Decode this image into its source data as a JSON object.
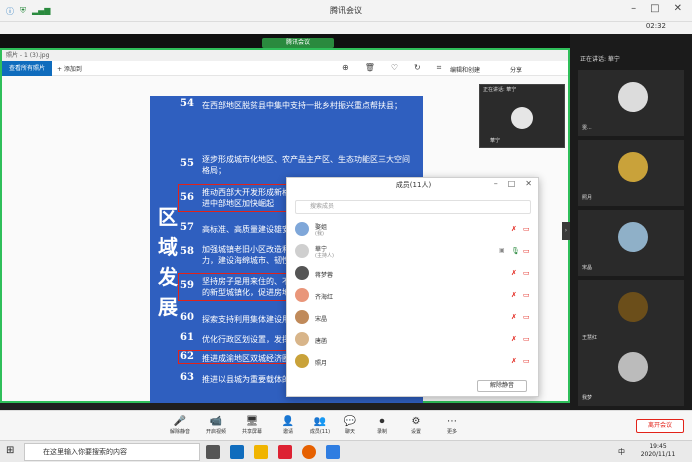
{
  "app": {
    "title": "腾讯会议",
    "time": "02:32"
  },
  "share": {
    "chip": "腾讯会议",
    "viewer_title": "照片 - 1 (3).jpg"
  },
  "viewer_toolbar": {
    "view_all": "查看所有照片",
    "add_to": "+ 添加到",
    "edit_create": "编辑和创建",
    "share": "分享"
  },
  "slide": {
    "vertical_title": [
      "区",
      "域",
      "发",
      "展"
    ],
    "items": [
      {
        "num": "54",
        "text": "在西部地区脱贫县中集中支持一批乡村振兴重点帮扶县；"
      },
      {
        "num": "55",
        "text": "逐步形成城市化地区、农产品主产区、生态功能区三大空间格局；"
      },
      {
        "num": "56",
        "text": "推动西部大开发形成新格局，推动东北振兴取得新突破，促进中部地区加快崛起"
      },
      {
        "num": "57",
        "text": "高标准、高质量建设雄安新区"
      },
      {
        "num": "58",
        "text": "加强城镇老旧小区改造和社区建设，增强城市防洪排涝能力，建设海绵城市、韧性城市"
      },
      {
        "num": "59",
        "text": "坚持房子是用来住的、不是用来炒的定位，推进以人为核心的新型城镇化，促进房地产市场平稳健康发展"
      },
      {
        "num": "60",
        "text": "探索支持利用集体建设用地按照规划建设租赁住房"
      },
      {
        "num": "61",
        "text": "优化行政区划设置，发挥中心城市和城市群带动作用"
      },
      {
        "num": "62",
        "text": "推进成渝地区双城经济圈建设"
      },
      {
        "num": "63",
        "text": "推进以县城为重要载体的城镇化建设"
      }
    ]
  },
  "cam_preview": {
    "label": "正在讲话: 華宁",
    "name": "華宁"
  },
  "members": {
    "title": "成员(11人)",
    "search_placeholder": "搜索成员",
    "list": [
      {
        "name": "娶姐",
        "sub": "(我)",
        "color": "#7fa7d9"
      },
      {
        "name": "華宁",
        "sub": "(主持人)",
        "color": "#cfcfcf"
      },
      {
        "name": "蒋梦蓉",
        "sub": "",
        "color": "#555"
      },
      {
        "name": "齐海红",
        "sub": "",
        "color": "#e9967a"
      },
      {
        "name": "宋晶",
        "sub": "",
        "color": "#c08a5a"
      },
      {
        "name": "唐菡",
        "sub": "",
        "color": "#d8b58a"
      },
      {
        "name": "照月",
        "sub": "",
        "color": "#c9a23a"
      }
    ],
    "unmute_all": "解除静音"
  },
  "right_panel": {
    "speaking": "正在讲话: 華宁",
    "tiles": [
      {
        "name": "雯...",
        "color": "#dcdcdc"
      },
      {
        "name": "照月",
        "color": "#c9a23a"
      },
      {
        "name": "宋晶",
        "color": "#8fb0c8"
      },
      {
        "name": "王慧红",
        "color": "#6b4e1a"
      },
      {
        "name": "我梦",
        "color": "#bbbbbb"
      }
    ]
  },
  "toolbar": {
    "items": [
      {
        "label": "解除静音",
        "icon": "🎤"
      },
      {
        "label": "开启视频",
        "icon": "📹"
      },
      {
        "label": "共享屏幕",
        "icon": "🖥"
      },
      {
        "label": "邀请",
        "icon": "👤"
      },
      {
        "label": "成员(11)",
        "icon": "👥"
      },
      {
        "label": "聊天",
        "icon": "💬"
      },
      {
        "label": "录制",
        "icon": "⏺"
      },
      {
        "label": "设置",
        "icon": "⚙"
      },
      {
        "label": "更多",
        "icon": "⋯"
      }
    ],
    "leave": "离开会议"
  },
  "taskbar": {
    "search_placeholder": "在这里输入你要搜索的内容",
    "time": "19:45",
    "date": "2020/11/11",
    "ime": "中"
  }
}
